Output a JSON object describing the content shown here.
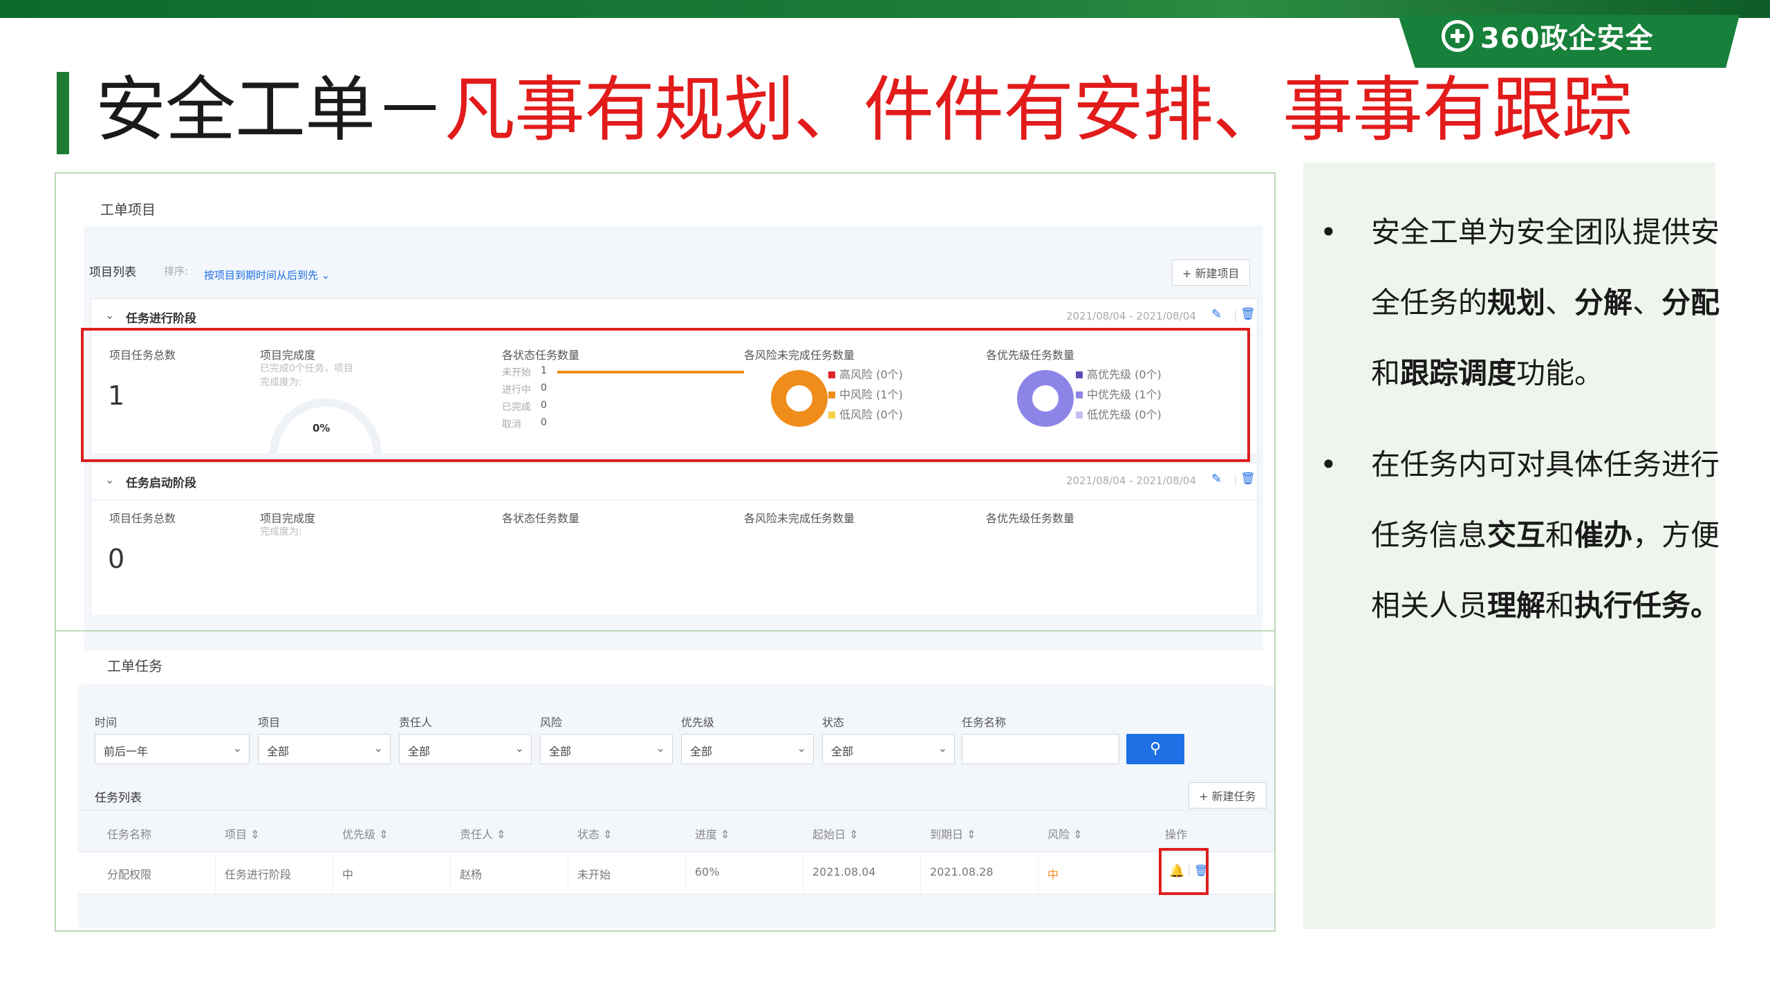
{
  "slide": {
    "brand": "360政企安全",
    "title_black": "安全工单－",
    "title_red": "凡事有规划、件件有安排、事事有跟踪",
    "bullets": [
      {
        "parts": [
          {
            "t": "安全工单为安全团队提供安全任务的",
            "b": false
          },
          {
            "t": "规划",
            "b": true
          },
          {
            "t": "、",
            "b": false
          },
          {
            "t": "分解",
            "b": true
          },
          {
            "t": "、",
            "b": false
          },
          {
            "t": "分配",
            "b": true
          },
          {
            "t": "和",
            "b": false
          },
          {
            "t": "跟踪调度",
            "b": true
          },
          {
            "t": "功能。",
            "b": false
          }
        ]
      },
      {
        "parts": [
          {
            "t": "在任务内可对具体任务进行任务信息",
            "b": false
          },
          {
            "t": "交互",
            "b": true
          },
          {
            "t": "和",
            "b": false
          },
          {
            "t": "催办",
            "b": true
          },
          {
            "t": "，方便相关人员",
            "b": false
          },
          {
            "t": "理解",
            "b": true
          },
          {
            "t": "和",
            "b": false
          },
          {
            "t": "执行任务。",
            "b": true
          }
        ]
      }
    ]
  },
  "projects": {
    "section_title": "工单项目",
    "list_label": "项目列表",
    "sort_label": "排序:",
    "sort_value": "按项目到期时间从后到先",
    "new_button": "+ 新建项目",
    "stages": [
      {
        "name": "任务进行阶段",
        "date_range": "2021/08/04 - 2021/08/04",
        "total_label": "项目任务总数",
        "total": "1",
        "completion_label": "项目完成度",
        "completion_sub1": "已完成0个任务，项目",
        "completion_sub2": "完成度为:",
        "completion_pct": "0%",
        "completion_value": 0,
        "status_label": "各状态任务数量",
        "status_rows": [
          {
            "label": "未开始",
            "count": "1",
            "value": 1
          },
          {
            "label": "进行中",
            "count": "0",
            "value": 0
          },
          {
            "label": "已完成",
            "count": "0",
            "value": 0
          },
          {
            "label": "取消",
            "count": "0",
            "value": 0
          }
        ],
        "risk_label": "各风险未完成任务数量",
        "risk_legend": [
          {
            "label": "高风险 (0个)",
            "color": "#e0252a"
          },
          {
            "label": "中风险 (1个)",
            "color": "#f08c1a"
          },
          {
            "label": "低风险 (0个)",
            "color": "#f2cf45"
          }
        ],
        "priority_label": "各优先级任务数量",
        "priority_legend": [
          {
            "label": "高优先级 (0个)",
            "color": "#5b4fb3"
          },
          {
            "label": "中优先级 (1个)",
            "color": "#8d84e8"
          },
          {
            "label": "低优先级 (0个)",
            "color": "#c3bef2"
          }
        ]
      },
      {
        "name": "任务启动阶段",
        "date_range": "2021/08/04 - 2021/08/04",
        "total_label": "项目任务总数",
        "total": "0",
        "completion_label": "项目完成度",
        "completion_sub1": "完成度为:",
        "status_label": "各状态任务数量",
        "risk_label": "各风险未完成任务数量",
        "priority_label": "各优先级任务数量"
      }
    ]
  },
  "tasks": {
    "section_title": "工单任务",
    "filters": [
      {
        "label": "时间",
        "value": "前后一年"
      },
      {
        "label": "项目",
        "value": "全部"
      },
      {
        "label": "责任人",
        "value": "全部"
      },
      {
        "label": "风险",
        "value": "全部"
      },
      {
        "label": "优先级",
        "value": "全部"
      },
      {
        "label": "状态",
        "value": "全部"
      }
    ],
    "name_filter_label": "任务名称",
    "name_filter_value": "",
    "list_label": "任务列表",
    "new_button": "+ 新建任务",
    "columns": [
      "任务名称",
      "项目 ⇕",
      "优先级 ⇕",
      "责任人 ⇕",
      "状态 ⇕",
      "进度 ⇕",
      "起始日 ⇕",
      "到期日 ⇕",
      "风险 ⇕",
      "操作"
    ],
    "rows": [
      [
        "分配权限",
        "任务进行阶段",
        "中",
        "赵杨",
        "未开始",
        "60%",
        "2021.08.04",
        "2021.08.28",
        "中"
      ]
    ]
  },
  "colors": {
    "brand_green": "#17803a",
    "title_red": "#e21b1b",
    "highlight_red": "#e01e1e",
    "accent_blue": "#1f6fe5",
    "risk_mid": "#f08c1a"
  }
}
